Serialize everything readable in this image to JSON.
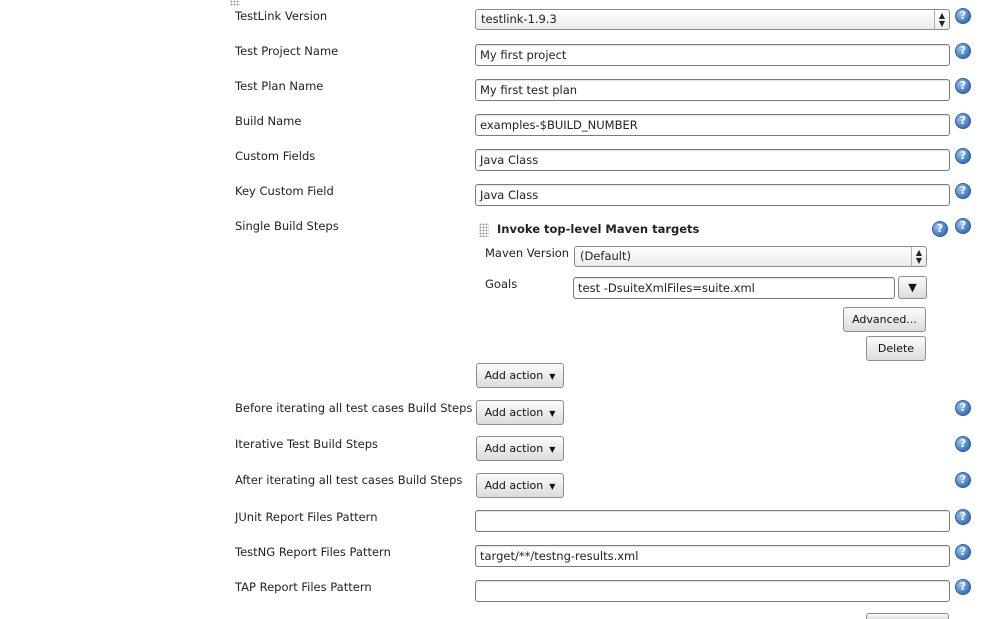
{
  "fields": {
    "testlink_version": {
      "label": "TestLink Version",
      "value": "testlink-1.9.3"
    },
    "project_name": {
      "label": "Test Project Name",
      "value": "My first project"
    },
    "plan_name": {
      "label": "Test Plan Name",
      "value": "My first test plan"
    },
    "build_name": {
      "label": "Build Name",
      "value": "examples-$BUILD_NUMBER"
    },
    "custom_fields": {
      "label": "Custom Fields",
      "value": "Java Class"
    },
    "key_custom_field": {
      "label": "Key Custom Field",
      "value": "Java Class"
    },
    "single_build_steps": {
      "label": "Single Build Steps"
    },
    "before_steps": {
      "label": "Before iterating all test cases Build Steps"
    },
    "iterative_steps": {
      "label": "Iterative Test Build Steps"
    },
    "after_steps": {
      "label": "After iterating all test cases Build Steps"
    },
    "junit_pattern": {
      "label": "JUnit Report Files Pattern",
      "value": ""
    },
    "testng_pattern": {
      "label": "TestNG Report Files Pattern",
      "value": "target/**/testng-results.xml"
    },
    "tap_pattern": {
      "label": "TAP Report Files Pattern",
      "value": ""
    }
  },
  "maven_step": {
    "title": "Invoke top-level Maven targets",
    "version_label": "Maven Version",
    "version_value": "(Default)",
    "goals_label": "Goals",
    "goals_value": "test -DsuiteXmlFiles=suite.xml",
    "expand_glyph": "▼",
    "advanced_label": "Advanced...",
    "delete_label": "Delete"
  },
  "buttons": {
    "add_action": "Add action"
  },
  "icons": {
    "help": "help-icon",
    "help_glyph": "?",
    "dropdown_caret": "▼",
    "select_arrows_up": "︿",
    "select_arrows_down": "﹀"
  },
  "colors": {
    "help_blue": "#3b73b9",
    "border": "#7b7b7b"
  }
}
